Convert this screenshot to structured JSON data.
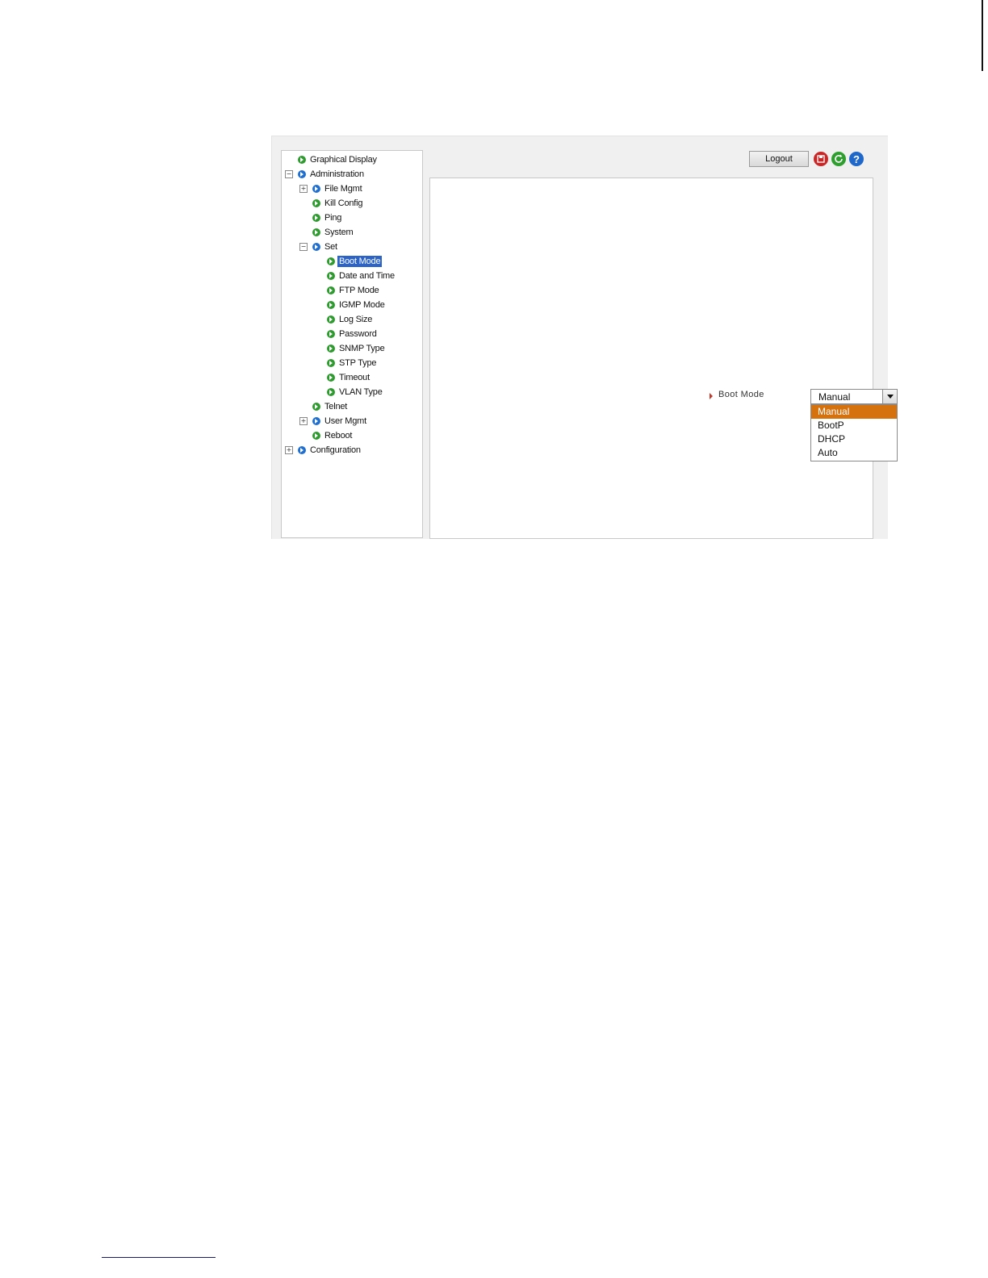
{
  "nav": {
    "items": [
      {
        "label": "Graphical Display",
        "expander": "",
        "color": "green"
      },
      {
        "label": "Administration",
        "expander": "minus",
        "color": "blue"
      },
      {
        "label": "File Mgmt",
        "expander": "plus",
        "color": "blue"
      },
      {
        "label": "Kill Config",
        "expander": "",
        "color": "green"
      },
      {
        "label": "Ping",
        "expander": "",
        "color": "green"
      },
      {
        "label": "System",
        "expander": "",
        "color": "green"
      },
      {
        "label": "Set",
        "expander": "minus",
        "color": "blue"
      },
      {
        "label": "Boot Mode",
        "expander": "",
        "color": "green",
        "selected": true
      },
      {
        "label": "Date and Time",
        "expander": "",
        "color": "green"
      },
      {
        "label": "FTP Mode",
        "expander": "",
        "color": "green"
      },
      {
        "label": "IGMP Mode",
        "expander": "",
        "color": "green"
      },
      {
        "label": "Log Size",
        "expander": "",
        "color": "green"
      },
      {
        "label": "Password",
        "expander": "",
        "color": "green"
      },
      {
        "label": "SNMP Type",
        "expander": "",
        "color": "green"
      },
      {
        "label": "STP Type",
        "expander": "",
        "color": "green"
      },
      {
        "label": "Timeout",
        "expander": "",
        "color": "green"
      },
      {
        "label": "VLAN Type",
        "expander": "",
        "color": "green"
      },
      {
        "label": "Telnet",
        "expander": "",
        "color": "green"
      },
      {
        "label": "User Mgmt",
        "expander": "plus",
        "color": "blue"
      },
      {
        "label": "Reboot",
        "expander": "",
        "color": "green"
      },
      {
        "label": "Configuration",
        "expander": "plus",
        "color": "blue"
      }
    ]
  },
  "toolbar": {
    "logout_label": "Logout",
    "icons": [
      "save-icon",
      "refresh-icon",
      "help-icon"
    ],
    "help_glyph": "?"
  },
  "form": {
    "boot_mode_label": "Boot Mode",
    "boot_mode_value": "Manual",
    "options": [
      "Manual",
      "BootP",
      "DHCP",
      "Auto"
    ],
    "highlighted_option": "Manual"
  },
  "colors": {
    "selected_nav": "#2b63c6",
    "dropdown_highlight": "#d5720d",
    "bullet_green": "#2e9b2e",
    "bullet_blue": "#1f6fd0"
  }
}
